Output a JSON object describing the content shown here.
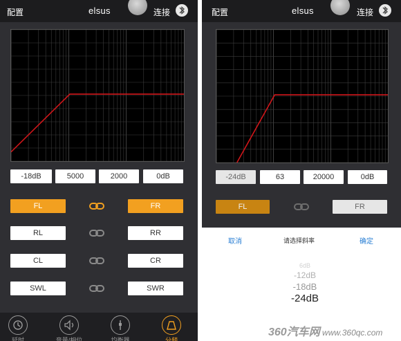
{
  "statusbar": {
    "config_label": "配置",
    "brand": "elsus",
    "connect_label": "连接"
  },
  "left": {
    "params": [
      "-18dB",
      "5000",
      "2000",
      "0dB"
    ],
    "channels": [
      {
        "left": "FL",
        "right": "FR",
        "linked": true
      },
      {
        "left": "RL",
        "right": "RR",
        "linked": false
      },
      {
        "left": "CL",
        "right": "CR",
        "linked": false
      },
      {
        "left": "SWL",
        "right": "SWR",
        "linked": false
      }
    ],
    "nav": [
      "延时",
      "音量/相位",
      "均衡器",
      "分频"
    ],
    "nav_selected": 3
  },
  "right": {
    "params": [
      "-24dB",
      "63",
      "20000",
      "0dB"
    ],
    "channels": [
      {
        "left": "FL",
        "right": "FR",
        "linked": false
      }
    ],
    "sheet": {
      "cancel": "取消",
      "prompt": "请选择斜率",
      "ok": "确定",
      "options": [
        "6dB",
        "-12dB",
        "-18dB",
        "-24dB"
      ],
      "selected": "-24dB"
    }
  },
  "watermark": {
    "big": "360汽车网",
    "url": "www.360qc.com"
  },
  "colors": {
    "accent": "#f2a020",
    "curve": "#d0161a",
    "background": "#2f2f33",
    "link_active": "#f2a020"
  },
  "icons": [
    "bluetooth-icon",
    "link-icon",
    "delay-icon",
    "volume-icon",
    "equalizer-icon",
    "crossover-icon"
  ]
}
